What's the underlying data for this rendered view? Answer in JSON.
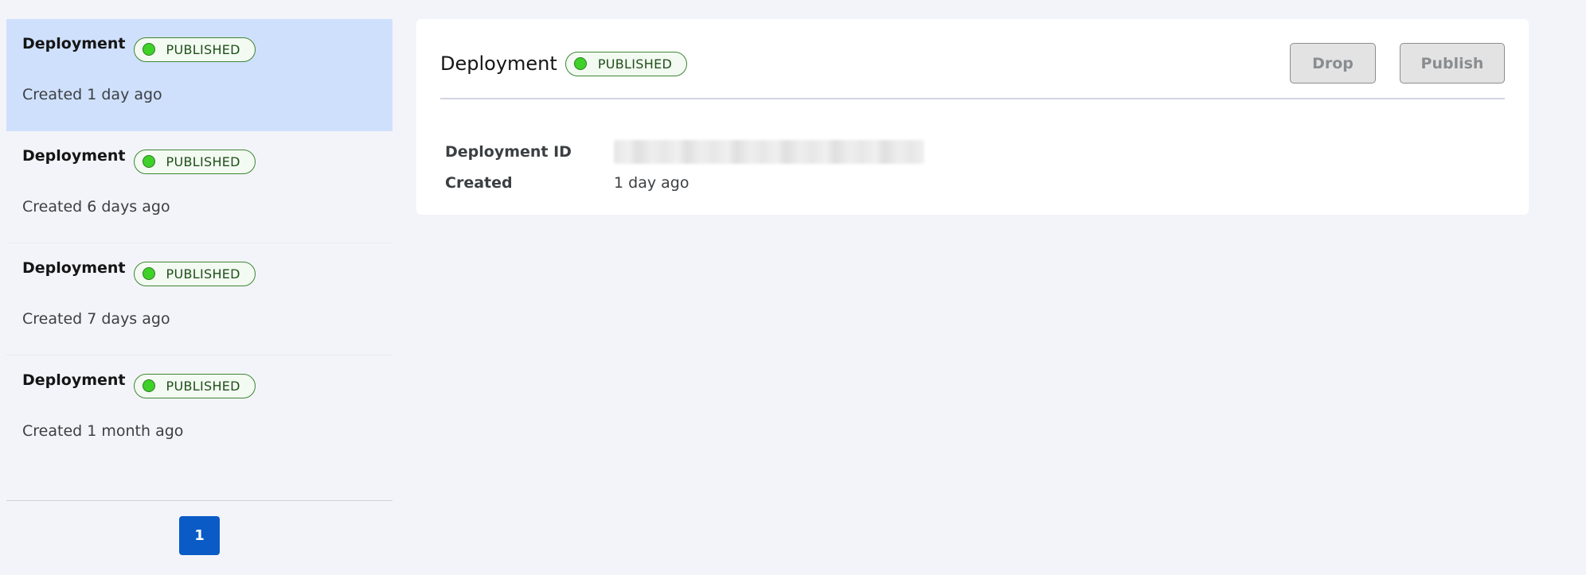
{
  "sidebar": {
    "items": [
      {
        "title": "Deployment",
        "status": "PUBLISHED",
        "created": "Created 1 day ago"
      },
      {
        "title": "Deployment",
        "status": "PUBLISHED",
        "created": "Created 6 days ago"
      },
      {
        "title": "Deployment",
        "status": "PUBLISHED",
        "created": "Created 7 days ago"
      },
      {
        "title": "Deployment",
        "status": "PUBLISHED",
        "created": "Created 1 month ago"
      }
    ],
    "pagination": {
      "current_page": "1"
    }
  },
  "detail": {
    "title": "Deployment",
    "status": "PUBLISHED",
    "drop_label": "Drop",
    "publish_label": "Publish",
    "deployment_id_label": "Deployment ID",
    "created_label": "Created",
    "created_value": "1 day ago"
  },
  "colors": {
    "selected_bg": "#cfe0fc",
    "status_green": "#3fd02a",
    "pager_blue": "#0a5bc6"
  }
}
